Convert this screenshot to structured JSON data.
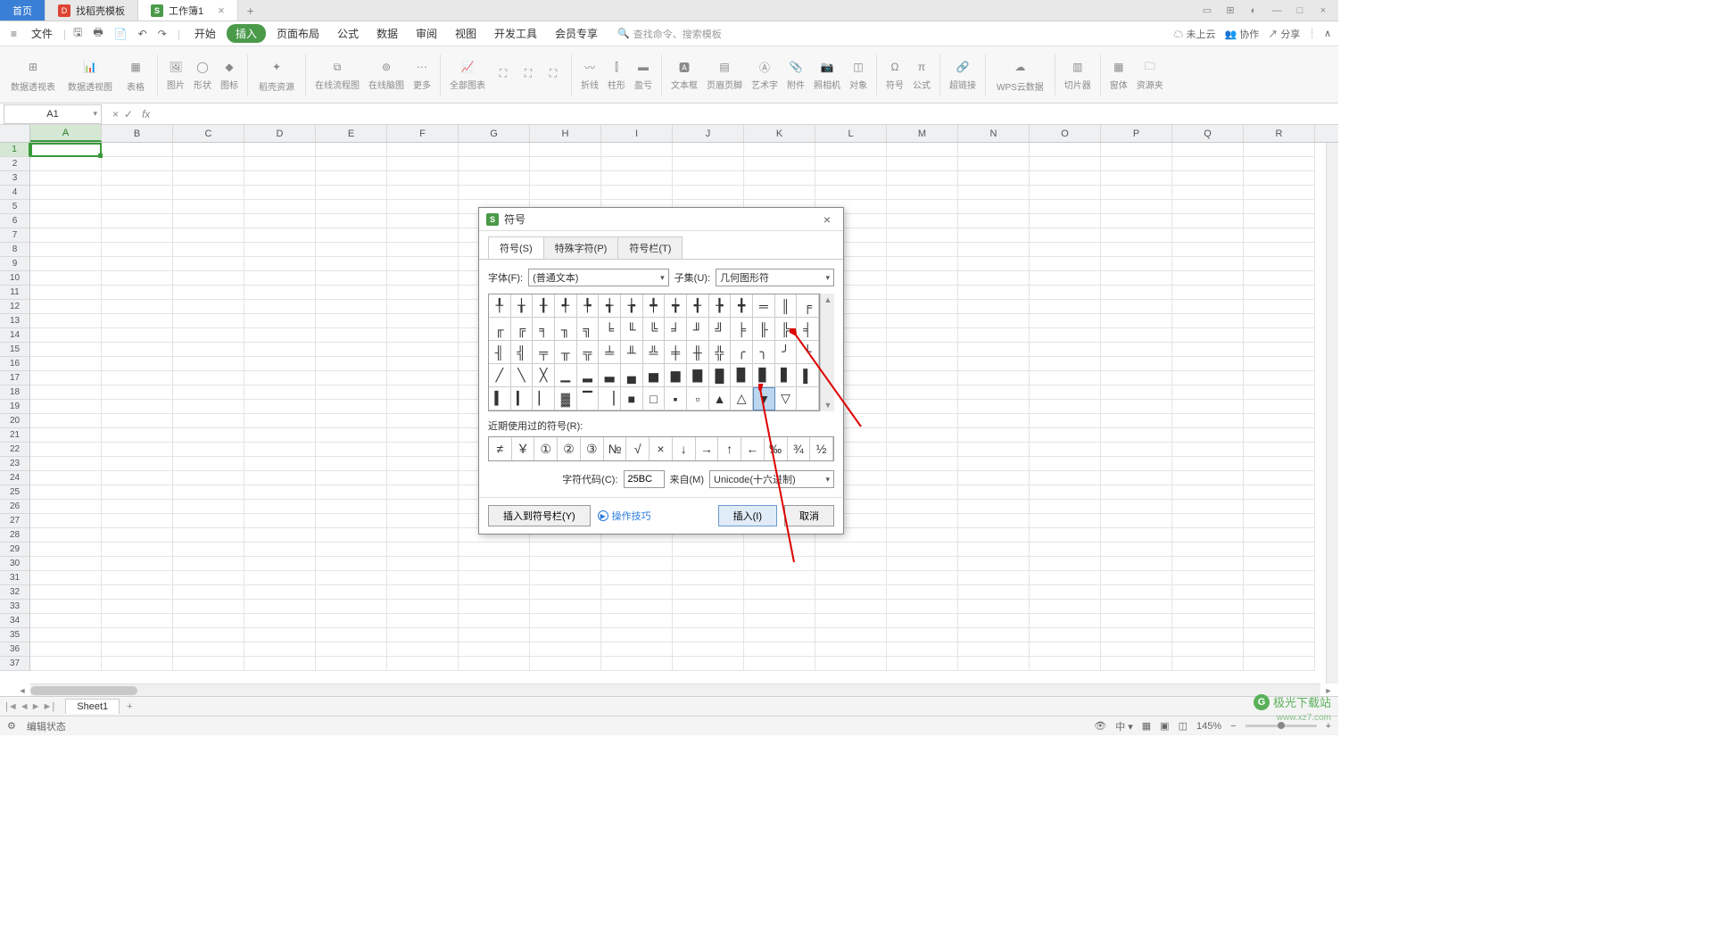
{
  "tabs": {
    "home": "首页",
    "template": "找稻壳模板",
    "workbook": "工作簿1"
  },
  "menu": {
    "file": "文件",
    "items": [
      "开始",
      "插入",
      "页面布局",
      "公式",
      "数据",
      "审阅",
      "视图",
      "开发工具",
      "会员专享"
    ],
    "active_index": 1,
    "search_placeholder": "查找命令、搜索模板",
    "cloud": "未上云",
    "coop": "协作",
    "share": "分享"
  },
  "toolbar": {
    "groups": [
      "数据透视表",
      "数据透视图",
      "表格",
      "图片",
      "形状",
      "图标",
      "稻壳资源",
      "在线流程图",
      "在线脑图",
      "更多",
      "全部图表",
      "折线",
      "柱形",
      "盈亏",
      "文本框",
      "页眉页脚",
      "艺术字",
      "附件",
      "照相机",
      "对象",
      "符号",
      "公式",
      "超链接",
      "WPS云数据",
      "切片器",
      "窗体",
      "资源夹"
    ]
  },
  "refbar": {
    "cell": "A1",
    "fx": "fx"
  },
  "columns": [
    "A",
    "B",
    "C",
    "D",
    "E",
    "F",
    "G",
    "H",
    "I",
    "J",
    "K",
    "L",
    "M",
    "N",
    "O",
    "P",
    "Q",
    "R"
  ],
  "sheet": {
    "name": "Sheet1"
  },
  "status": {
    "text": "编辑状态",
    "zoom": "145%"
  },
  "dialog": {
    "title": "符号",
    "tabs": [
      "符号(S)",
      "特殊字符(P)",
      "符号栏(T)"
    ],
    "font_label": "字体(F):",
    "font_value": "(普通文本)",
    "subset_label": "子集(U):",
    "subset_value": "几何图形符",
    "symbols": [
      "╀",
      "╁",
      "╂",
      "╃",
      "╄",
      "╅",
      "╆",
      "╇",
      "╈",
      "╉",
      "╊",
      "╋",
      "═",
      "║",
      "╒",
      "╓",
      "╔",
      "╕",
      "╖",
      "╗",
      "╘",
      "╙",
      "╚",
      "╛",
      "╜",
      "╝",
      "╞",
      "╟",
      "╠",
      "╡",
      "╢",
      "╣",
      "╤",
      "╥",
      "╦",
      "╧",
      "╨",
      "╩",
      "╪",
      "╫",
      "╬",
      "╭",
      "╮",
      "╯",
      "╰",
      "╱",
      "╲",
      "╳",
      "▁",
      "▂",
      "▃",
      "▄",
      "▅",
      "▆",
      "▇",
      "█",
      "▉",
      "▊",
      "▋",
      "▌",
      "▍",
      "▎",
      "▏",
      "▓",
      "▔",
      "▕",
      "■",
      "□",
      "▪",
      "▫",
      "▲",
      "△",
      "▼",
      "▽",
      ""
    ],
    "selected_index": 72,
    "recent_label": "近期使用过的符号(R):",
    "recent": [
      "≠",
      "￥",
      "①",
      "②",
      "③",
      "№",
      "√",
      "×",
      "↓",
      "→",
      "↑",
      "←",
      "‰",
      "¾",
      "½"
    ],
    "code_label": "字符代码(C):",
    "code_value": "25BC",
    "from_label": "来自(M)",
    "from_value": "Unicode(十六进制)",
    "insert_bar": "插入到符号栏(Y)",
    "tips": "操作技巧",
    "insert_btn": "插入(I)",
    "cancel_btn": "取消"
  },
  "watermark": {
    "brand": "极光下载站",
    "url": "www.xz7.com"
  }
}
